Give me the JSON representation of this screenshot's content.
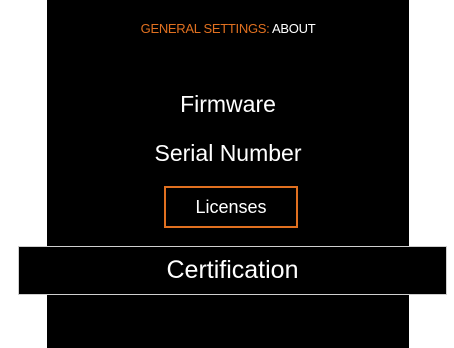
{
  "header": {
    "section": "GENERAL SETTINGS:",
    "page": "ABOUT"
  },
  "menu": {
    "items": [
      {
        "label": "Firmware"
      },
      {
        "label": "Serial Number"
      },
      {
        "label": "Licenses"
      },
      {
        "label": "Certification"
      }
    ]
  },
  "colors": {
    "accent": "#e07020",
    "background": "#000000",
    "text": "#ffffff"
  }
}
